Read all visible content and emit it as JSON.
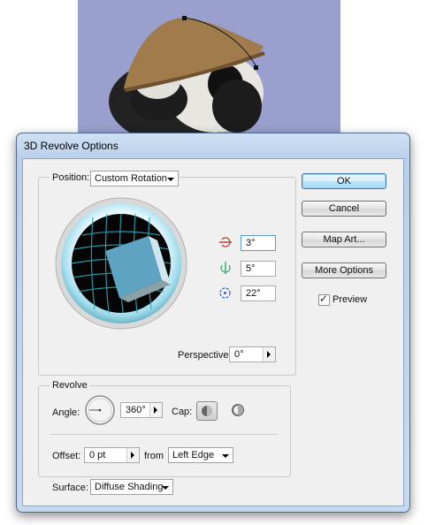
{
  "dialog": {
    "title": "3D Revolve Options",
    "position_label": "Position:",
    "position_value": "Custom Rotation",
    "rotation": {
      "x": "3°",
      "y": "5°",
      "z": "22°"
    },
    "perspective_label": "Perspective:",
    "perspective_value": "0°",
    "revolve_label": "Revolve",
    "angle_label": "Angle:",
    "angle_value": "360°",
    "cap_label": "Cap:",
    "offset_label": "Offset:",
    "offset_value": "0 pt",
    "from_label": "from",
    "from_value": "Left Edge",
    "surface_label": "Surface:",
    "surface_value": "Diffuse Shading",
    "buttons": {
      "ok": "OK",
      "cancel": "Cancel",
      "map_art": "Map Art...",
      "more_options": "More Options"
    },
    "preview_label": "Preview",
    "preview_checked": true
  },
  "colors": {
    "artboard_bg": "#9aa0cd",
    "hat": "#a07c4c",
    "cube_face": "#5fa3c2",
    "default_button_border": "#3c7fb1"
  }
}
